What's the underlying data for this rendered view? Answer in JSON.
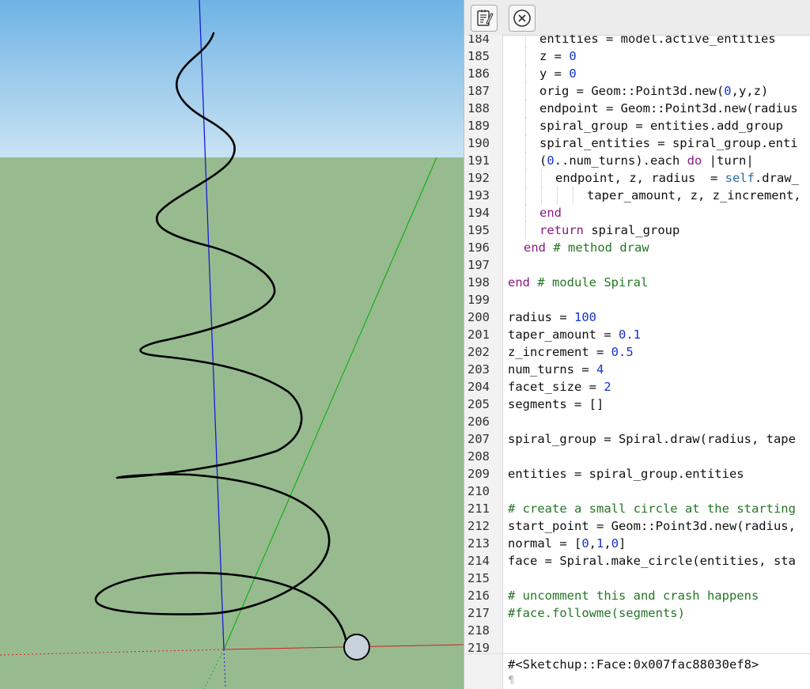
{
  "toolbar": {
    "edit_button_icon": "notepad-edit-icon",
    "close_button_icon": "close-circle-icon"
  },
  "editor": {
    "lines": [
      {
        "n": "184",
        "indent": 2,
        "segs": [
          {
            "t": "entities = model.active_entities"
          }
        ]
      },
      {
        "n": "185",
        "indent": 2,
        "segs": [
          {
            "t": "z = "
          },
          {
            "t": "0",
            "c": "num"
          }
        ]
      },
      {
        "n": "186",
        "indent": 2,
        "segs": [
          {
            "t": "y = "
          },
          {
            "t": "0",
            "c": "num"
          }
        ]
      },
      {
        "n": "187",
        "indent": 2,
        "segs": [
          {
            "t": "orig = Geom::Point3d.new("
          },
          {
            "t": "0",
            "c": "num"
          },
          {
            "t": ",y,z)"
          }
        ]
      },
      {
        "n": "188",
        "indent": 2,
        "segs": [
          {
            "t": "endpoint = Geom::Point3d.new(radius"
          }
        ]
      },
      {
        "n": "189",
        "indent": 2,
        "segs": [
          {
            "t": "spiral_group = entities.add_group"
          }
        ]
      },
      {
        "n": "190",
        "indent": 2,
        "segs": [
          {
            "t": "spiral_entities = spiral_group.enti"
          }
        ]
      },
      {
        "n": "191",
        "indent": 2,
        "segs": [
          {
            "t": "("
          },
          {
            "t": "0",
            "c": "num"
          },
          {
            "t": "..num_turns).each "
          },
          {
            "t": "do",
            "c": "kw"
          },
          {
            "t": " |turn|"
          }
        ]
      },
      {
        "n": "192",
        "indent": 3,
        "segs": [
          {
            "t": "endpoint, z, radius  = "
          },
          {
            "t": "self",
            "c": "fn"
          },
          {
            "t": ".draw_"
          }
        ]
      },
      {
        "n": "193",
        "indent": 5,
        "segs": [
          {
            "t": "taper_amount, z, z_increment,"
          }
        ]
      },
      {
        "n": "194",
        "indent": 2,
        "segs": [
          {
            "t": "end",
            "c": "kw"
          }
        ]
      },
      {
        "n": "195",
        "indent": 2,
        "segs": [
          {
            "t": "return",
            "c": "kw"
          },
          {
            "t": " spiral_group"
          }
        ]
      },
      {
        "n": "196",
        "indent": 1,
        "segs": [
          {
            "t": "end",
            "c": "kw"
          },
          {
            "t": " # method draw",
            "c": "cm"
          }
        ]
      },
      {
        "n": "197",
        "indent": 0,
        "segs": []
      },
      {
        "n": "198",
        "indent": 0,
        "segs": [
          {
            "t": "end",
            "c": "kw"
          },
          {
            "t": " # module Spiral",
            "c": "cm"
          }
        ]
      },
      {
        "n": "199",
        "indent": 0,
        "segs": []
      },
      {
        "n": "200",
        "indent": 0,
        "segs": [
          {
            "t": "radius = "
          },
          {
            "t": "100",
            "c": "num"
          }
        ]
      },
      {
        "n": "201",
        "indent": 0,
        "segs": [
          {
            "t": "taper_amount = "
          },
          {
            "t": "0.1",
            "c": "num"
          }
        ]
      },
      {
        "n": "202",
        "indent": 0,
        "segs": [
          {
            "t": "z_increment = "
          },
          {
            "t": "0.5",
            "c": "num"
          }
        ]
      },
      {
        "n": "203",
        "indent": 0,
        "segs": [
          {
            "t": "num_turns = "
          },
          {
            "t": "4",
            "c": "num"
          }
        ]
      },
      {
        "n": "204",
        "indent": 0,
        "segs": [
          {
            "t": "facet_size = "
          },
          {
            "t": "2",
            "c": "num"
          }
        ]
      },
      {
        "n": "205",
        "indent": 0,
        "segs": [
          {
            "t": "segments = []"
          }
        ]
      },
      {
        "n": "206",
        "indent": 0,
        "segs": []
      },
      {
        "n": "207",
        "indent": 0,
        "segs": [
          {
            "t": "spiral_group = Spiral.draw(radius, tape"
          }
        ]
      },
      {
        "n": "208",
        "indent": 0,
        "segs": []
      },
      {
        "n": "209",
        "indent": 0,
        "segs": [
          {
            "t": "entities = spiral_group.entities"
          }
        ]
      },
      {
        "n": "210",
        "indent": 0,
        "segs": []
      },
      {
        "n": "211",
        "indent": 0,
        "segs": [
          {
            "t": "# create a small circle at the starting",
            "c": "cm"
          }
        ]
      },
      {
        "n": "212",
        "indent": 0,
        "segs": [
          {
            "t": "start_point = Geom::Point3d.new(radius,"
          }
        ]
      },
      {
        "n": "213",
        "indent": 0,
        "segs": [
          {
            "t": "normal = ["
          },
          {
            "t": "0",
            "c": "num"
          },
          {
            "t": ","
          },
          {
            "t": "1",
            "c": "num"
          },
          {
            "t": ","
          },
          {
            "t": "0",
            "c": "num"
          },
          {
            "t": "]"
          }
        ]
      },
      {
        "n": "214",
        "indent": 0,
        "segs": [
          {
            "t": "face = Spiral.make_circle(entities, sta"
          }
        ]
      },
      {
        "n": "215",
        "indent": 0,
        "segs": []
      },
      {
        "n": "216",
        "indent": 0,
        "segs": [
          {
            "t": "# uncomment this and crash happens",
            "c": "cm"
          }
        ]
      },
      {
        "n": "217",
        "indent": 0,
        "segs": [
          {
            "t": "#face.followme(segments)",
            "c": "cm"
          }
        ]
      },
      {
        "n": "218",
        "indent": 0,
        "segs": []
      },
      {
        "n": "219",
        "indent": 0,
        "segs": []
      }
    ]
  },
  "output": {
    "result": "#<Sketchup::Face:0x007fac88030ef8>",
    "pilcrow": "¶"
  },
  "colors": {
    "sky": "#86bfe6",
    "ground": "#97bb8f",
    "z_axis": "#1a1ad6",
    "x_axis": "#d21f1f",
    "y_axis": "#17b017",
    "keyword": "#8a1a82",
    "number": "#1533c7",
    "comment": "#267626"
  }
}
